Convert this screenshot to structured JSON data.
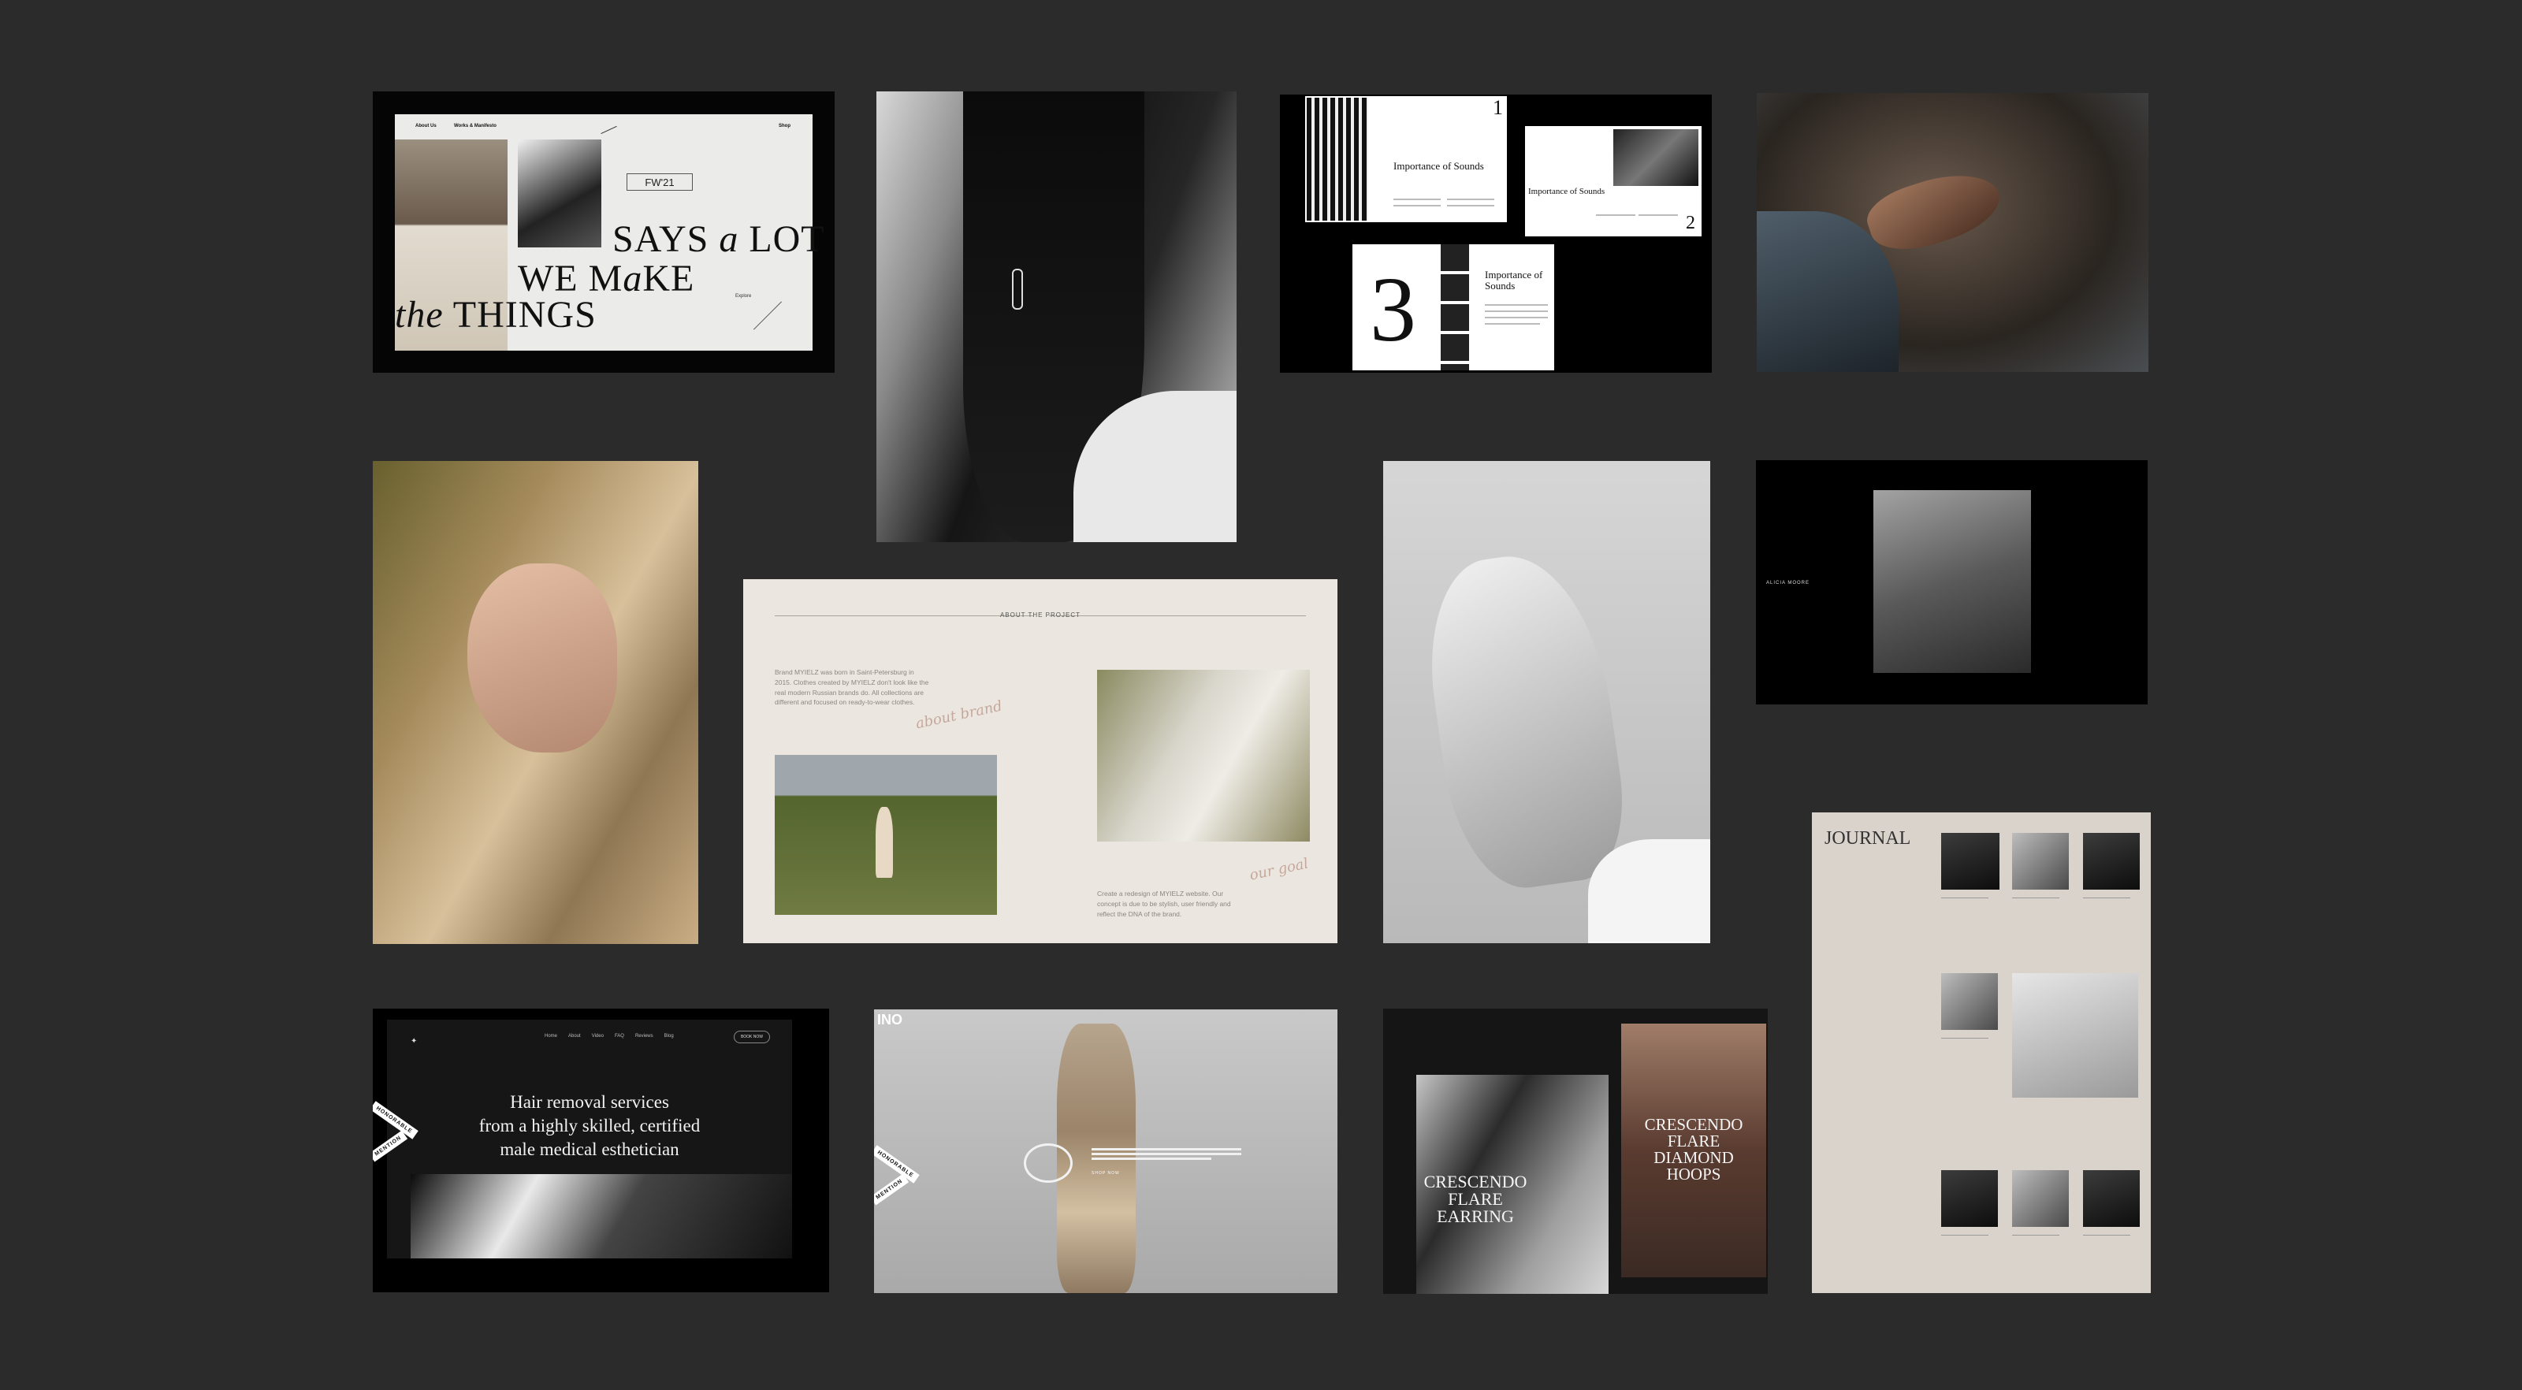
{
  "tile1": {
    "nav": [
      "About Us",
      "Works & Manifesto",
      "Shop"
    ],
    "badge": "FW'21",
    "line1_a": "SAYS ",
    "line1_b": "a",
    "line1_c": " LOT",
    "line2_a": "WE M",
    "line2_b": "a",
    "line2_c": "KE",
    "line3_a": "the",
    "line3_b": " THINGS",
    "corner_label": "Explore"
  },
  "tile3": {
    "num1": "1",
    "num2": "2",
    "num3": "3",
    "heading": "Importance\nof Sounds"
  },
  "tile6": {
    "left_label": "ALICIA MOORE"
  },
  "tile7": {
    "title": "ABOUT THE PROJECT",
    "paragraph1": "Brand MYIELZ was born in Saint-Petersburg in 2015. Clothes created by MYIELZ don't look like the real modern Russian brands do. All collections are different and focused on ready-to-wear clothes.",
    "script1": "about brand",
    "script2": "our goal",
    "paragraph2": "Create a redesign of MYIELZ website. Our concept is due to be stylish, user friendly and reflect the DNA of the brand."
  },
  "tile10": {
    "nav": [
      "Home",
      "About",
      "Video",
      "FAQ",
      "Reviews",
      "Blog"
    ],
    "cta": "BOOK NOW",
    "hero_line1": "Hair removal services",
    "hero_line2": "from a highly skilled, certified",
    "hero_line3": "male medical esthetician",
    "ribbon1": "HONORABLE",
    "ribbon2": "MENTION"
  },
  "tile11": {
    "logo": "INO",
    "ribbon1": "HONORABLE",
    "ribbon2": "MENTION",
    "cta": "SHOP NOW"
  },
  "tile12": {
    "left_title": "CRESCENDO\nFLARE\nEARRING",
    "right_title": "CRESCENDO\nFLARE\nDIAMOND\nHOOPS"
  },
  "tile13": {
    "title": "JOURNAL"
  }
}
